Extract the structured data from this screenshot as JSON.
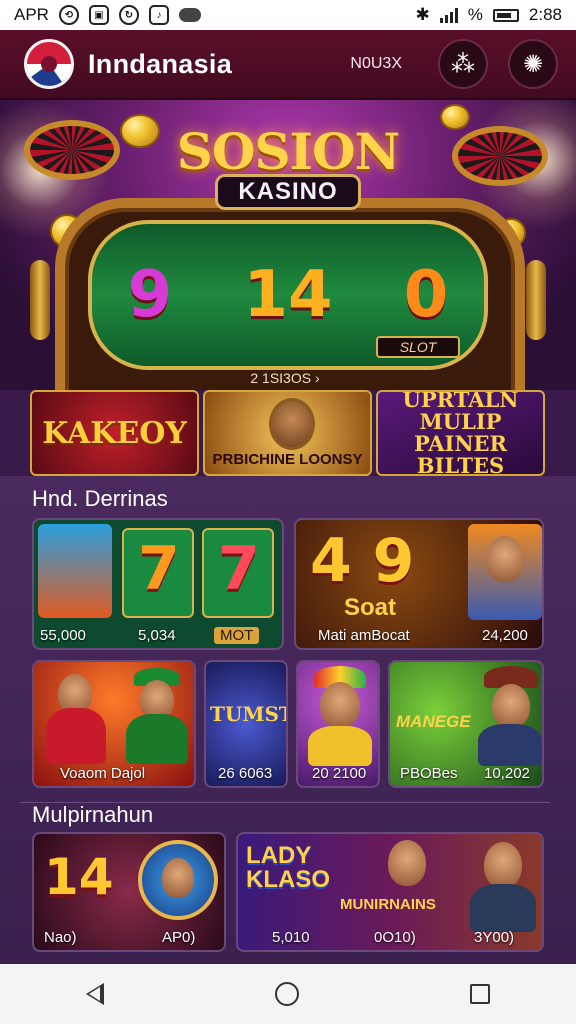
{
  "status_bar": {
    "carrier": "APR",
    "time": "2:88",
    "icons": [
      "clock-icon",
      "notification-icon",
      "sync-icon",
      "note-icon",
      "cloud-icon",
      "bluetooth-icon",
      "signal-icon",
      "wifi-icon",
      "battery-icon"
    ]
  },
  "header": {
    "app_name": "Inndanasia",
    "notice": "N0U3X",
    "buttons": [
      "profile-icon",
      "settings-icon"
    ]
  },
  "hero": {
    "title": "SOSION",
    "subtitle": "KASINO",
    "reels": [
      "9",
      "14",
      "0"
    ],
    "slot_tag": "SLOT",
    "pager": "2  1SI3OS  ›"
  },
  "promos": [
    {
      "label": "KAKEOY"
    },
    {
      "label": "PRBICHINE LOONSY"
    },
    {
      "label": "UPRTALN MULIP PAINER BILTES"
    }
  ],
  "section1": {
    "title": "Hnd. Derrinas",
    "cards": [
      {
        "digits": [
          "7",
          "7"
        ],
        "values": [
          "55,000",
          "5,034",
          "MOT"
        ]
      },
      {
        "digits": "4 9",
        "sub": "Soat",
        "values": [
          "Mati amBocat",
          "24,200"
        ]
      },
      {
        "label": "Voaom Dajol"
      },
      {
        "label": "TUMST",
        "value": "26 6063"
      },
      {
        "value": "20 2100"
      },
      {
        "label": "MANEGE",
        "values": [
          "PBOBes",
          "10,202"
        ]
      }
    ]
  },
  "section2": {
    "title": "Mulpirnahun",
    "cards": [
      {
        "digits": "14",
        "values": [
          "Nao)",
          "AP0)"
        ]
      },
      {
        "label": "LADY KLASO",
        "sub": "MUNIRNAINS",
        "values": [
          "5,010",
          "0O10)",
          "3Y00)"
        ]
      }
    ]
  },
  "colors": {
    "header_bg": "#5a0f2a",
    "page_bg": "#4a2a5e",
    "accent_gold": "#ffd44a",
    "reel_green": "#1f8a3e"
  }
}
